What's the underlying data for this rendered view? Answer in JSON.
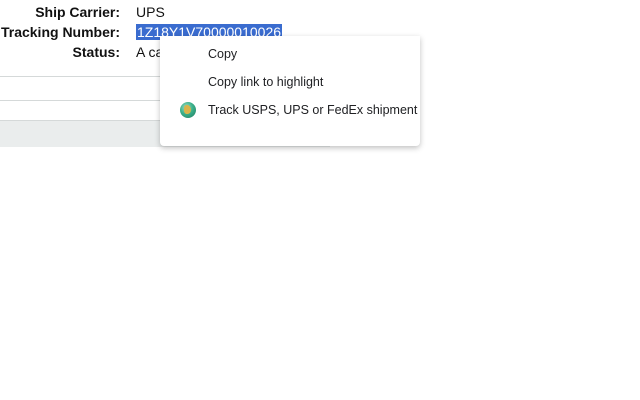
{
  "shipment": {
    "carrier_label": "Ship Carrier:",
    "carrier_value": "UPS",
    "tracking_label": "Tracking Number:",
    "tracking_value": "1Z18Y1V70000010026",
    "status_label": "Status:",
    "status_value": "A ca"
  },
  "context_menu": {
    "items": [
      {
        "label": "Copy",
        "icon": ""
      },
      {
        "label": "Copy link to highlight",
        "icon": ""
      },
      {
        "label": "Track USPS, UPS or FedEx shipment",
        "icon": "globe-icon"
      }
    ]
  },
  "colors": {
    "selection": "#3a6ccf",
    "menu_text": "#202124",
    "footer_bg": "#eaeded"
  }
}
